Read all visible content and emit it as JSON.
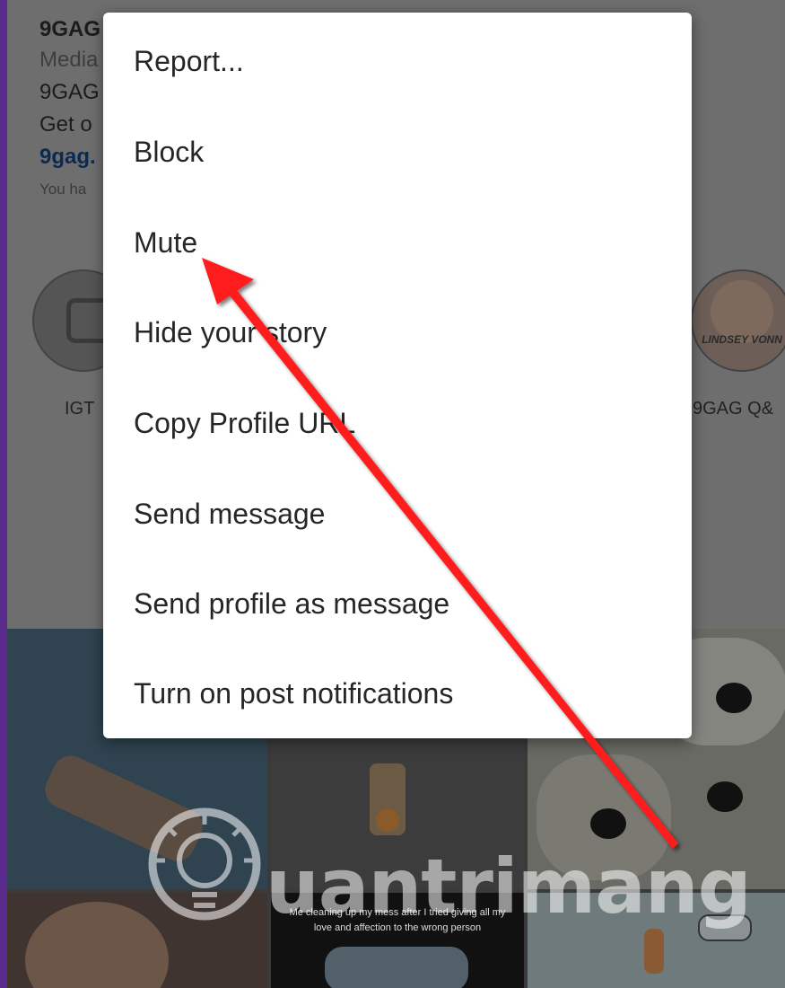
{
  "profile": {
    "name": "9GAG",
    "category": "Media",
    "bio_line": "9GAG",
    "bio_line2": "Get o",
    "link": "9gag.",
    "followed_by": "You ha"
  },
  "highlights": [
    {
      "label": "IGT",
      "icon": "igtv-icon"
    },
    {
      "label": "9GAG Q&",
      "cover_text": "LINDSEY VONN"
    }
  ],
  "grid": {
    "caption": "Me cleaning up my mess after I tried giving all my love and affection to the wrong person"
  },
  "menu": {
    "items": [
      {
        "label": "Report..."
      },
      {
        "label": "Block"
      },
      {
        "label": "Mute"
      },
      {
        "label": "Hide your story"
      },
      {
        "label": "Copy Profile URL"
      },
      {
        "label": "Send message"
      },
      {
        "label": "Send profile as message"
      },
      {
        "label": "Turn on post notifications"
      }
    ]
  },
  "annotation": {
    "color": "#ff1a1a",
    "points_to": "Mute"
  },
  "watermark": {
    "text": "uantrimang",
    "icon": "lightbulb-icon"
  },
  "colors": {
    "frame": "#5a2b8c",
    "dim_overlay": "#6e6e6e"
  }
}
